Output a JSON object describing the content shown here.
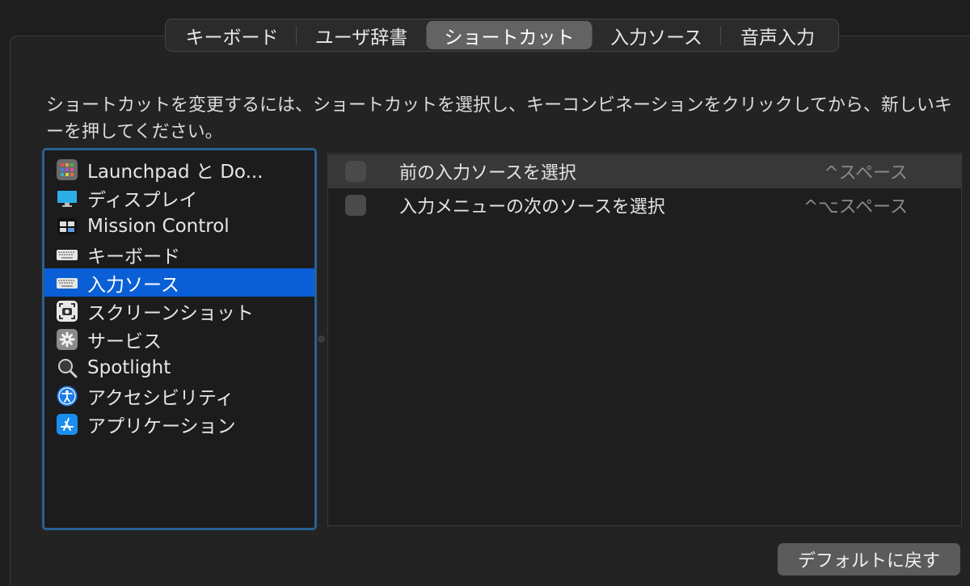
{
  "tabs": [
    {
      "label": "キーボード",
      "selected": false
    },
    {
      "label": "ユーザ辞書",
      "selected": false
    },
    {
      "label": "ショートカット",
      "selected": true
    },
    {
      "label": "入力ソース",
      "selected": false
    },
    {
      "label": "音声入力",
      "selected": false
    }
  ],
  "instructions": "ショートカットを変更するには、ショートカットを選択し、キーコンビネーションをクリックしてから、新しいキーを押してください。",
  "categories": [
    {
      "label": "Launchpad と Do...",
      "icon": "launchpad-icon"
    },
    {
      "label": "ディスプレイ",
      "icon": "display-icon"
    },
    {
      "label": "Mission Control",
      "icon": "mission-control-icon"
    },
    {
      "label": "キーボード",
      "icon": "keyboard-icon"
    },
    {
      "label": "入力ソース",
      "icon": "keyboard-icon",
      "selected": true
    },
    {
      "label": "スクリーンショット",
      "icon": "screenshot-icon"
    },
    {
      "label": "サービス",
      "icon": "gear-icon"
    },
    {
      "label": "Spotlight",
      "icon": "magnifier-icon"
    },
    {
      "label": "アクセシビリティ",
      "icon": "accessibility-icon"
    },
    {
      "label": "アプリケーション",
      "icon": "app-store-icon"
    }
  ],
  "shortcuts": [
    {
      "label": "前の入力ソースを選択",
      "keys": "^スペース",
      "checked": false,
      "highlighted": true
    },
    {
      "label": "入力メニューの次のソースを選択",
      "keys": "^⌥スペース",
      "checked": false,
      "highlighted": false
    }
  ],
  "default_button": "デフォルトに戻す",
  "colors": {
    "selection": "#0a5fd7",
    "focus_ring": "#2a6191",
    "background": "#1e1e1e"
  }
}
